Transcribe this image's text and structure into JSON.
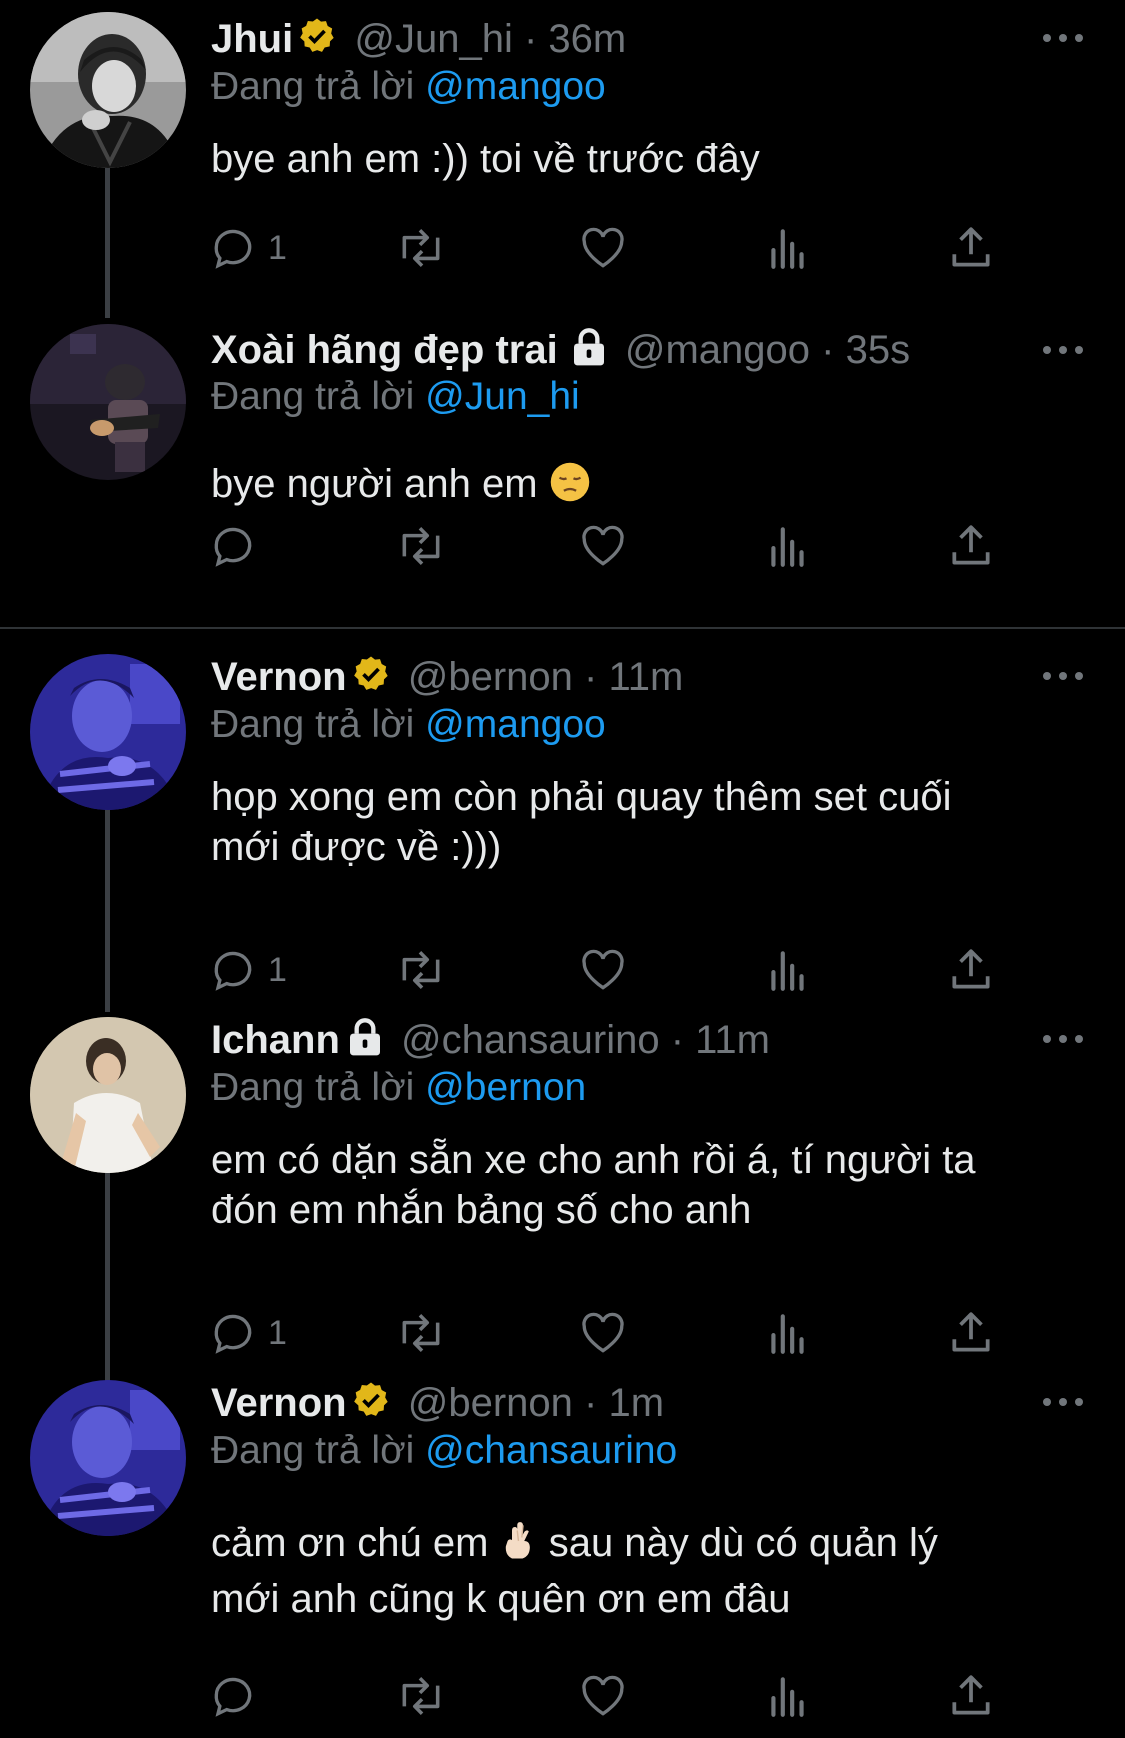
{
  "reply_prefix": "Đang trả lời",
  "tweets": [
    {
      "name": "Jhui",
      "handle": "@Jun_hi",
      "dot": "·",
      "time": "36m",
      "badge": "verified-badge",
      "replying_to": "@mangoo",
      "text": "bye anh em :)) toi về trước đây",
      "reply_count": "1"
    },
    {
      "name": "Xoài hãng đẹp trai",
      "handle": "@mangoo",
      "dot": "·",
      "time": "35s",
      "badge": "lock-icon",
      "replying_to": "@Jun_hi",
      "text": "bye người anh em",
      "emoji": "pensive-face",
      "reply_count": ""
    },
    {
      "name": "Vernon",
      "handle": "@bernon",
      "dot": "·",
      "time": "11m",
      "badge": "verified-badge",
      "replying_to": "@mangoo",
      "text_line1": "họp xong em còn phải quay thêm set cuối",
      "text_line2": "mới được về :)))",
      "reply_count": "1"
    },
    {
      "name": "Ichann",
      "handle": "@chansaurino",
      "dot": "·",
      "time": "11m",
      "badge": "lock-icon",
      "replying_to": "@bernon",
      "text_line1": "em có dặn sẵn xe cho anh rồi á, tí người ta",
      "text_line2": "đón em nhắn bảng số cho anh",
      "reply_count": "1"
    },
    {
      "name": "Vernon",
      "handle": "@bernon",
      "dot": "·",
      "time": "1m",
      "badge": "verified-badge",
      "replying_to": "@chansaurino",
      "text_line1_a": "cảm ơn chú em",
      "emoji": "crossed-fingers",
      "text_line1_b": "sau này dù có quản lý",
      "text_line2": "mới anh cũng k quên ơn em đâu",
      "reply_count": ""
    }
  ],
  "colors": {
    "background": "#000000",
    "text": "#e7e9ea",
    "muted": "#71767b",
    "link": "#1d9bf0",
    "verified": "#e2b719"
  }
}
